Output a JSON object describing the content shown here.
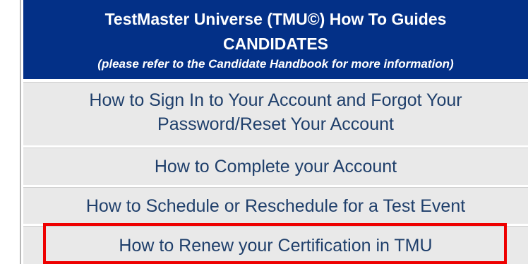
{
  "header": {
    "title": "TestMaster Universe (TMU©) How To Guides",
    "subtitle": "CANDIDATES",
    "note": "(please refer to the Candidate Handbook for more information)",
    "background_color": "#033087",
    "text_color": "#ffffff"
  },
  "guides": [
    {
      "label_line1": "How to Sign In to Your Account and Forgot Your",
      "label_line2": "Password/Reset Your Account"
    },
    {
      "label": "How to Complete your Account"
    },
    {
      "label": "How to Schedule or Reschedule for a Test Event"
    },
    {
      "label": "How to Renew your Certification in TMU"
    }
  ],
  "row_background_color": "#e9e9e9",
  "row_text_color": "#1f3f6b",
  "highlight_color": "#ee0000"
}
